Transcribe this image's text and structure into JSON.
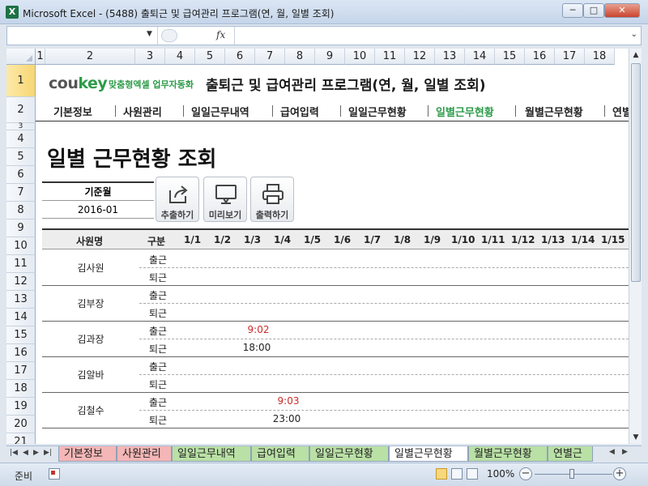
{
  "window": {
    "app_letter": "X",
    "title": "Microsoft Excel - (5488) 출퇴근 및 급여관리 프로그램(연, 월, 일별 조회)",
    "min": "─",
    "max": "□",
    "close": "✕"
  },
  "formula_bar": {
    "name_box": "",
    "fx": "fx",
    "formula": ""
  },
  "columns": [
    "1",
    "2",
    "3",
    "4",
    "5",
    "6",
    "7",
    "8",
    "9",
    "10",
    "11",
    "12",
    "13",
    "14",
    "15",
    "16",
    "17",
    "18"
  ],
  "rows": [
    "1",
    "2",
    "3",
    "4",
    "5",
    "6",
    "7",
    "8",
    "9",
    "10",
    "11",
    "12",
    "13",
    "14",
    "15",
    "16",
    "17",
    "18",
    "19",
    "20",
    "21"
  ],
  "sheet": {
    "brand_prefix": "cou",
    "brand_suffix": "key",
    "tagline": "맞춤형엑셀 업무자동화",
    "app_title": "출퇴근 및 급여관리 프로그램(연, 월, 일별 조회)",
    "nav": [
      "기본정보",
      "사원관리",
      "일일근무내역",
      "급여입력",
      "일일근무현황",
      "일별근무현황",
      "월별근무현황",
      "연별"
    ],
    "active_nav": "일별근무현황",
    "page_heading": "일별 근무현황 조회",
    "base_month_label": "기준월",
    "base_month_value": "2016-01",
    "actions": {
      "export": "추출하기",
      "preview": "미리보기",
      "print": "출력하기"
    },
    "table": {
      "col_employee": "사원명",
      "col_type": "구분",
      "days": [
        "1/1",
        "1/2",
        "1/3",
        "1/4",
        "1/5",
        "1/6",
        "1/7",
        "1/8",
        "1/9",
        "1/10",
        "1/11",
        "1/12",
        "1/13",
        "1/14",
        "1/15"
      ],
      "clock_in": "출근",
      "clock_out": "퇴근",
      "employees": [
        {
          "name": "김사원"
        },
        {
          "name": "김부장"
        },
        {
          "name": "김과장",
          "in_time": "9:02",
          "out_time": "18:00"
        },
        {
          "name": "김알바"
        },
        {
          "name": "김철수",
          "in_time": "9:03",
          "out_time": "23:00"
        }
      ]
    }
  },
  "sheet_tabs": [
    "기본정보",
    "사원관리",
    "일일근무내역",
    "급여입력",
    "일일근무현황",
    "일별근무현황",
    "월별근무현황",
    "연별근"
  ],
  "active_tab": "일별근무현황",
  "status": {
    "ready": "준비",
    "zoom": "100%"
  },
  "colors": {
    "accent_green": "#2e9b4a",
    "late_red": "#cc2a2a",
    "tab_colors": [
      "#f4b6b6",
      "#f4b6b6",
      "#b9e0a5",
      "#b9e0a5",
      "#b9e0a5",
      "#ffffff",
      "#b9e0a5",
      "#b9e0a5"
    ]
  }
}
